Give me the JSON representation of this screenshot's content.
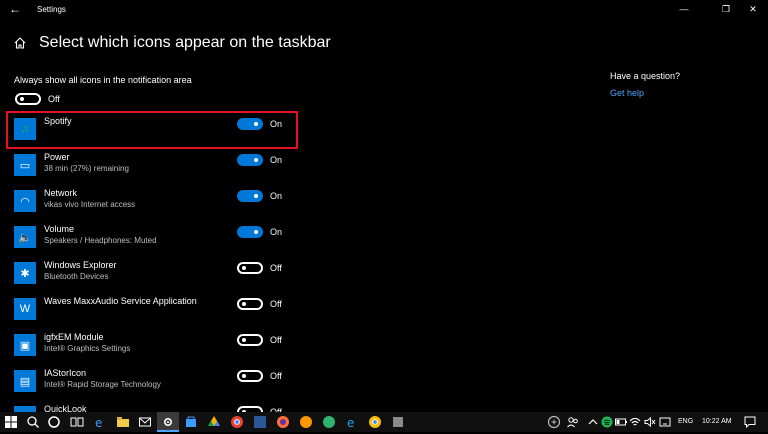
{
  "window": {
    "title": "Settings",
    "minimize": "—",
    "maximize": "❐",
    "close": "✕",
    "back": "←"
  },
  "header": {
    "title": "Select which icons appear on the taskbar"
  },
  "master": {
    "label": "Always show all icons in the notification area",
    "state": "Off"
  },
  "rows": [
    {
      "name": "Spotify",
      "sub": "",
      "state": "On",
      "icon": "♫"
    },
    {
      "name": "Power",
      "sub": "38 min (27%) remaining",
      "state": "On",
      "icon": "▭"
    },
    {
      "name": "Network",
      "sub": "vikas vivo Internet access",
      "state": "On",
      "icon": "◠"
    },
    {
      "name": "Volume",
      "sub": "Speakers / Headphones: Muted",
      "state": "On",
      "icon": "🔈"
    },
    {
      "name": "Windows Explorer",
      "sub": "Bluetooth Devices",
      "state": "Off",
      "icon": "✱"
    },
    {
      "name": "Waves MaxxAudio Service Application",
      "sub": "",
      "state": "Off",
      "icon": "W"
    },
    {
      "name": "igfxEM Module",
      "sub": "Intel® Graphics Settings",
      "state": "Off",
      "icon": "▣"
    },
    {
      "name": "IAStorIcon",
      "sub": "Intel® Rapid Storage Technology",
      "state": "Off",
      "icon": "▤"
    },
    {
      "name": "QuickLook",
      "sub": "",
      "state": "Off",
      "icon": "◉"
    }
  ],
  "sidebar": {
    "question": "Have a question?",
    "link": "Get help"
  },
  "taskbar": {
    "language": "ENG",
    "time": "10:22 AM"
  },
  "colors": {
    "accent": "#0078d7",
    "highlight": "#e81123",
    "link": "#4aa3ff"
  }
}
